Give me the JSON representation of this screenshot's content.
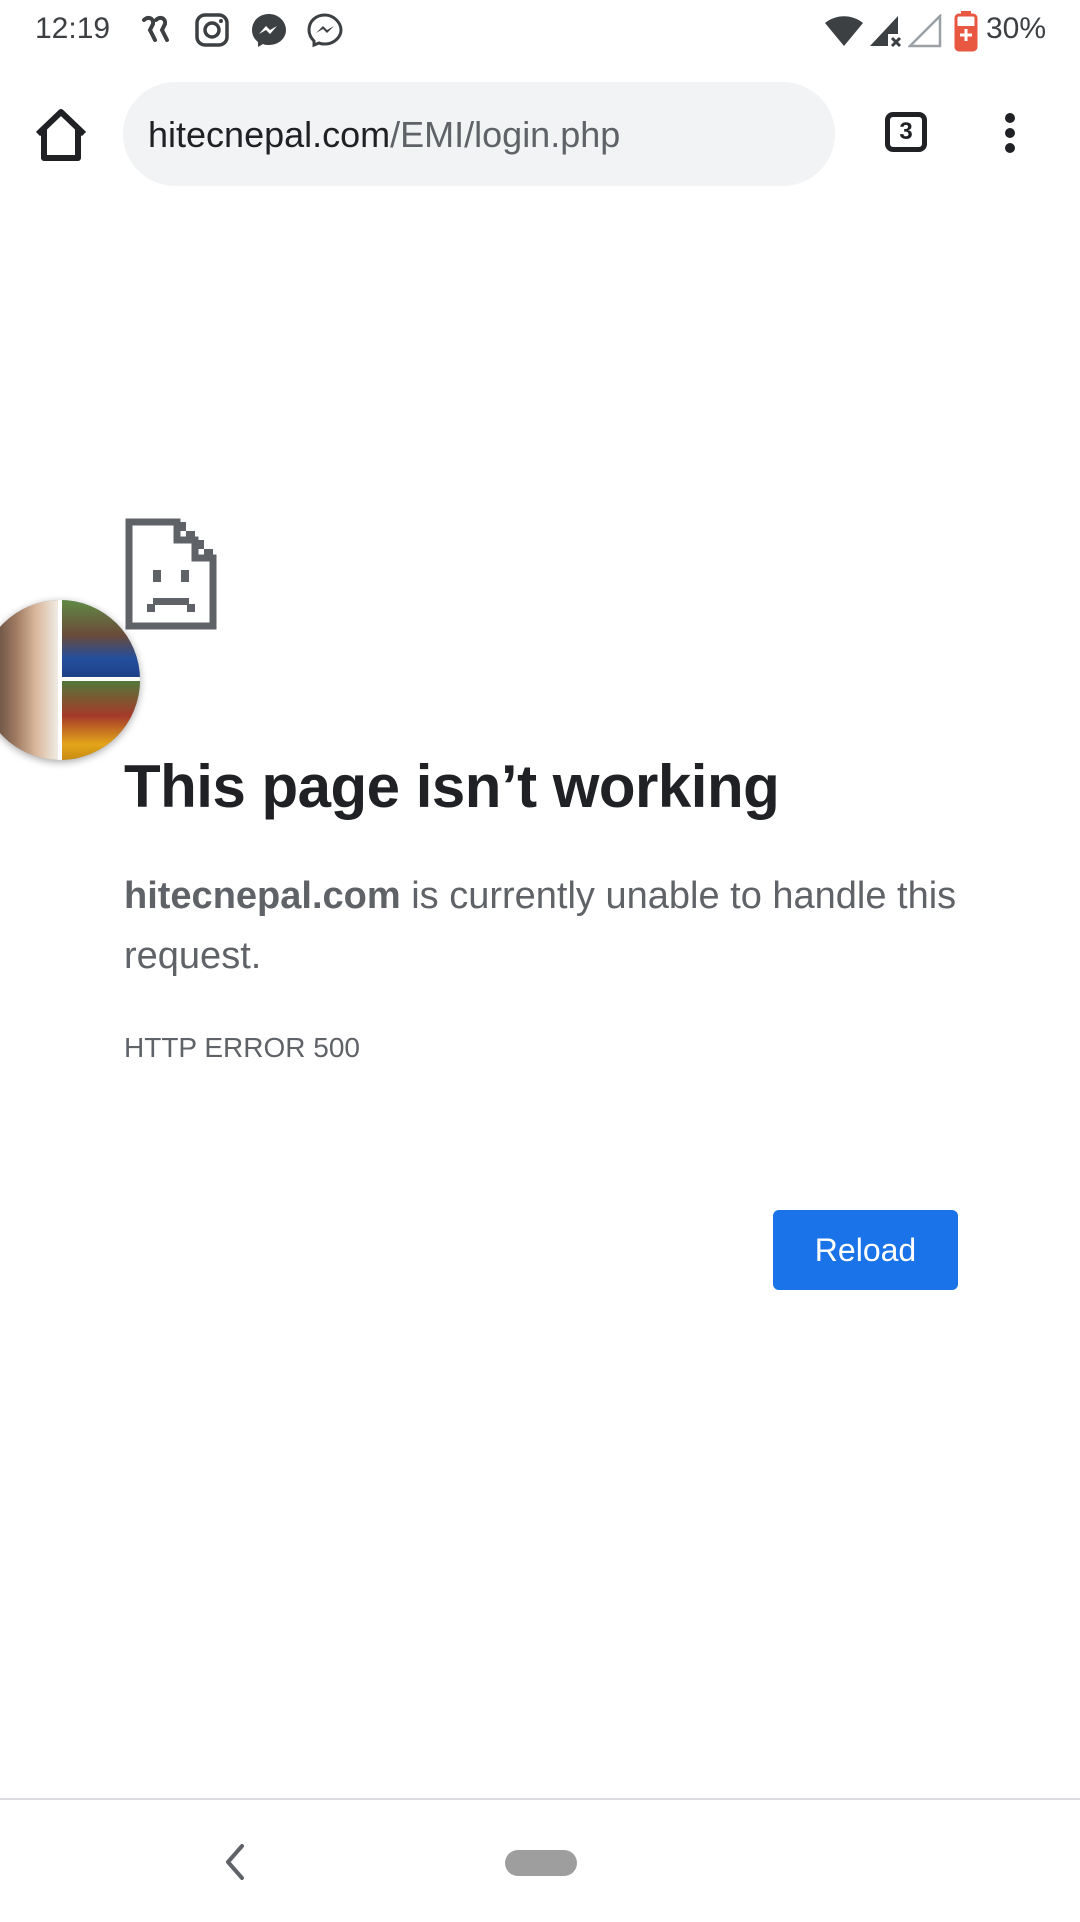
{
  "status_bar": {
    "time": "12:19",
    "notification_icons": [
      "carrier-app-icon",
      "instagram-icon",
      "messenger-icon",
      "messenger-outline-icon"
    ],
    "system_icons": [
      "wifi-icon",
      "cell-signal-no-data-icon",
      "cell-signal-empty-icon",
      "battery-saver-icon"
    ],
    "battery_percent": "30%",
    "battery_color": "#e8573f"
  },
  "toolbar": {
    "url_host": "hitecnepal.com",
    "url_path": "/EMI/login.php",
    "tab_count": "3"
  },
  "error_page": {
    "icon": "sad-page-icon",
    "title": "This page isn’t working",
    "host": "hitecnepal.com",
    "description": " is currently unable to handle this request.",
    "error_code": "HTTP ERROR 500",
    "reload_label": "Reload",
    "accent": "#1a73e8"
  },
  "chat_head": {
    "type": "messenger-chat-head-avatar"
  },
  "nav_bar": {
    "icons": [
      "back-icon",
      "home-pill-icon"
    ]
  }
}
